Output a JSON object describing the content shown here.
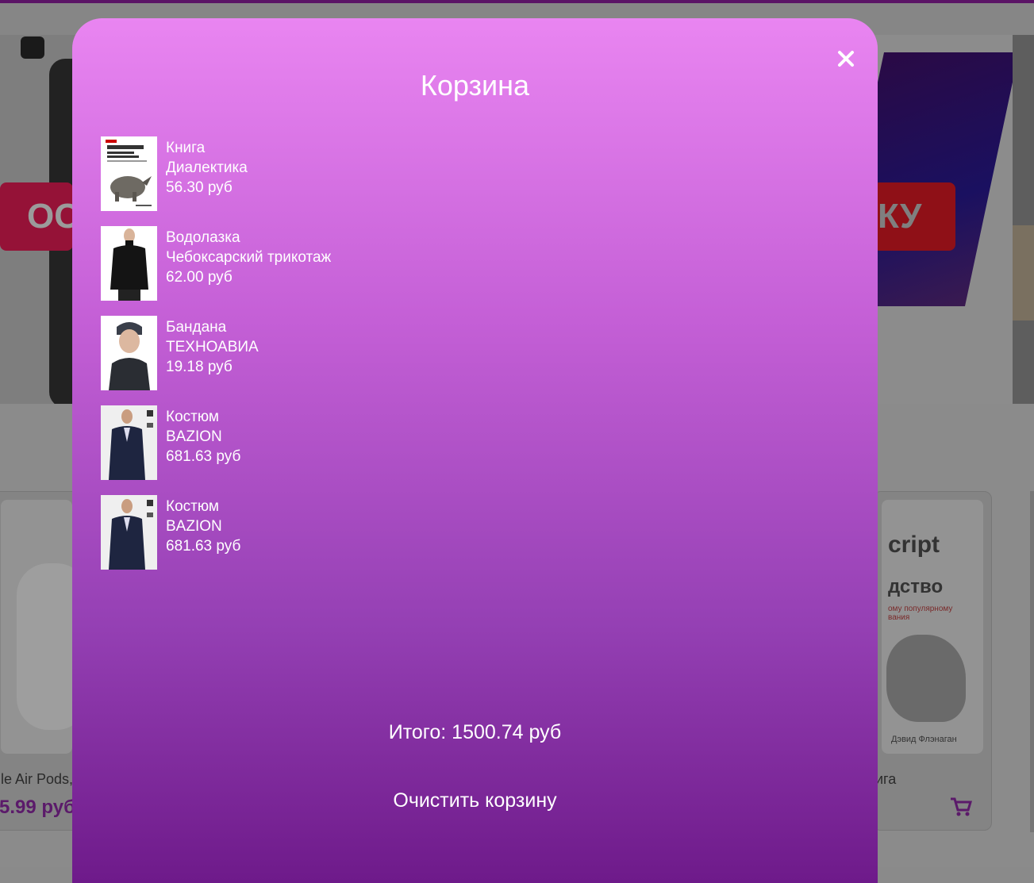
{
  "modal": {
    "title": "Корзина",
    "close_icon": "close-icon",
    "items": [
      {
        "name": "Книга",
        "brand": "Диалектика",
        "price": "56.30 руб",
        "image": "javascript-book-thumbnail"
      },
      {
        "name": "Водолазка",
        "brand": "Чебоксарский трикотаж",
        "price": "62.00 руб",
        "image": "turtleneck-thumbnail"
      },
      {
        "name": "Бандана",
        "brand": "ТЕХНОАВИА",
        "price": "19.18 руб",
        "image": "bandana-thumbnail"
      },
      {
        "name": "Костюм",
        "brand": "BAZION",
        "price": "681.63 руб",
        "image": "suit-thumbnail"
      },
      {
        "name": "Костюм",
        "brand": "BAZION",
        "price": "681.63 руб",
        "image": "suit-thumbnail"
      }
    ],
    "total": "Итого: 1500.74 руб",
    "clear_label": "Очистить корзину"
  },
  "background": {
    "promo_left": "ОС",
    "promo_right": "КУ",
    "card_left_title": "le Air Pods,",
    "card_left_price": "5.99 руб",
    "card_right_title": "ига",
    "card_right_book_line1": "cript",
    "card_right_book_line2": "дство",
    "card_right_book_line3": "ому популярному",
    "card_right_book_line4": "вания",
    "card_right_book_author": "Дэвид Флэнаган",
    "card_right_cart_icon": "cart-icon"
  },
  "colors": {
    "modal_top": "#e985f1",
    "modal_bottom": "#6e1a8a",
    "overlay": "#8a8a8a",
    "price_accent": "#5b1a6a"
  }
}
